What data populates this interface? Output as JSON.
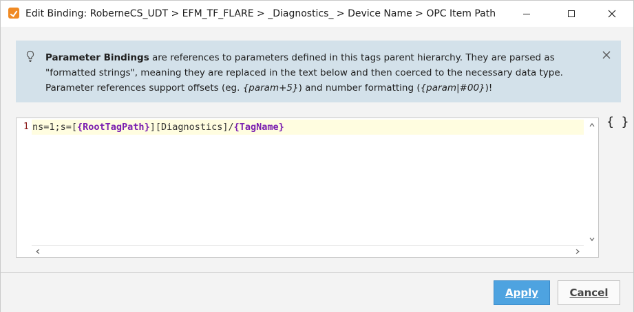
{
  "window": {
    "title": "Edit Binding: RoberneCS_UDT > EFM_TF_FLARE > _Diagnostics_ > Device Name > OPC Item Path",
    "icons": {
      "app": "edit-binding-app-icon",
      "minimize": "minimize-icon",
      "maximize": "maximize-icon",
      "close": "close-icon"
    }
  },
  "info": {
    "icon": "lightbulb-icon",
    "bold_lead": "Parameter Bindings",
    "text_1": " are references to parameters defined in this tags parent hierarchy. They are parsed as \"formatted strings\", meaning they are replaced in the text below and then coerced to the necessary data type. Parameter references support offsets (eg. ",
    "example_offset": "{param+5}",
    "text_2": ") and number formatting (",
    "example_format": "{param|#00}",
    "text_3": ")!",
    "close_icon": "close-icon"
  },
  "editor": {
    "line_number": "1",
    "code_prefix": "ns=1;s=[",
    "token_1": "{RootTagPath}",
    "code_middle": "][Diagnostics]/",
    "token_2": "{TagName}",
    "token_color": "#7a1fb0"
  },
  "side": {
    "insert_param_label": "{ }"
  },
  "footer": {
    "apply_label": "Apply",
    "cancel_label": "Cancel",
    "apply_color": "#4ea3e0"
  }
}
